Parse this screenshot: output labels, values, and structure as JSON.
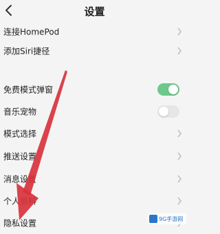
{
  "header": {
    "title": "设置",
    "back_icon": "chevron-left-icon"
  },
  "rows": [
    {
      "label": "连接HomePod",
      "control": "chevron"
    },
    {
      "label": "添加Siri捷径",
      "control": "chevron"
    },
    {
      "label": "免费模式弹窗",
      "control": "toggle",
      "on": true
    },
    {
      "label": "音乐宠物",
      "control": "toggle",
      "on": false
    },
    {
      "label": "模式选择",
      "control": "chevron"
    },
    {
      "label": "推送设置",
      "control": "chevron"
    },
    {
      "label": "消息设置",
      "control": "chevron"
    },
    {
      "label": "个人资料",
      "control": "chevron"
    },
    {
      "label": "隐私设置",
      "control": "chevron"
    }
  ],
  "colors": {
    "toggle_on": "#6cc98a",
    "toggle_off": "#e6e6e6",
    "arrow": "#d8323c",
    "background": "#f4f4f4"
  },
  "annotation": {
    "type": "red-arrow",
    "points_to": "隐私设置"
  },
  "watermark": {
    "text": "9G手游网"
  }
}
